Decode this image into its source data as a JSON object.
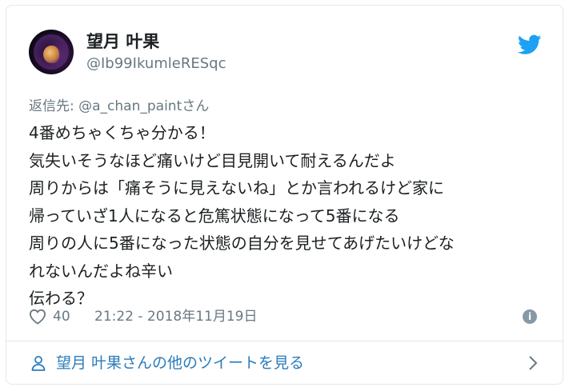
{
  "author": {
    "display_name": "望月 叶果",
    "handle": "@Ib99IkumleRESqc"
  },
  "reply_to": "返信先: @a_chan_paintさん",
  "tweet_lines": [
    "4番めちゃくちゃ分かる！",
    "気失いそうなほど痛いけど目見開いて耐えるんだよ",
    "周りからは「痛そうに見えないね」とか言われるけど家に",
    "帰っていざ1人になると危篤状態になって5番になる",
    "周りの人に5番になった状態の自分を見せてあげたいけどな",
    "れないんだよね辛い",
    "伝わる？"
  ],
  "meta": {
    "like_count": "40",
    "timestamp": "21:22 - 2018年11月19日",
    "info_glyph": "i"
  },
  "footer": {
    "link_label": "望月 叶果さんの他のツイートを見る"
  },
  "colors": {
    "twitter_blue": "#1da1f2",
    "link_blue": "#2b7bb9",
    "muted_text": "#697882",
    "primary_text": "#1c2022",
    "border": "#e1e8ed"
  },
  "icons": {
    "brand": "twitter-bird-icon",
    "like": "heart-icon",
    "info": "info-icon",
    "profile": "person-icon",
    "forward": "chevron-right-icon"
  }
}
